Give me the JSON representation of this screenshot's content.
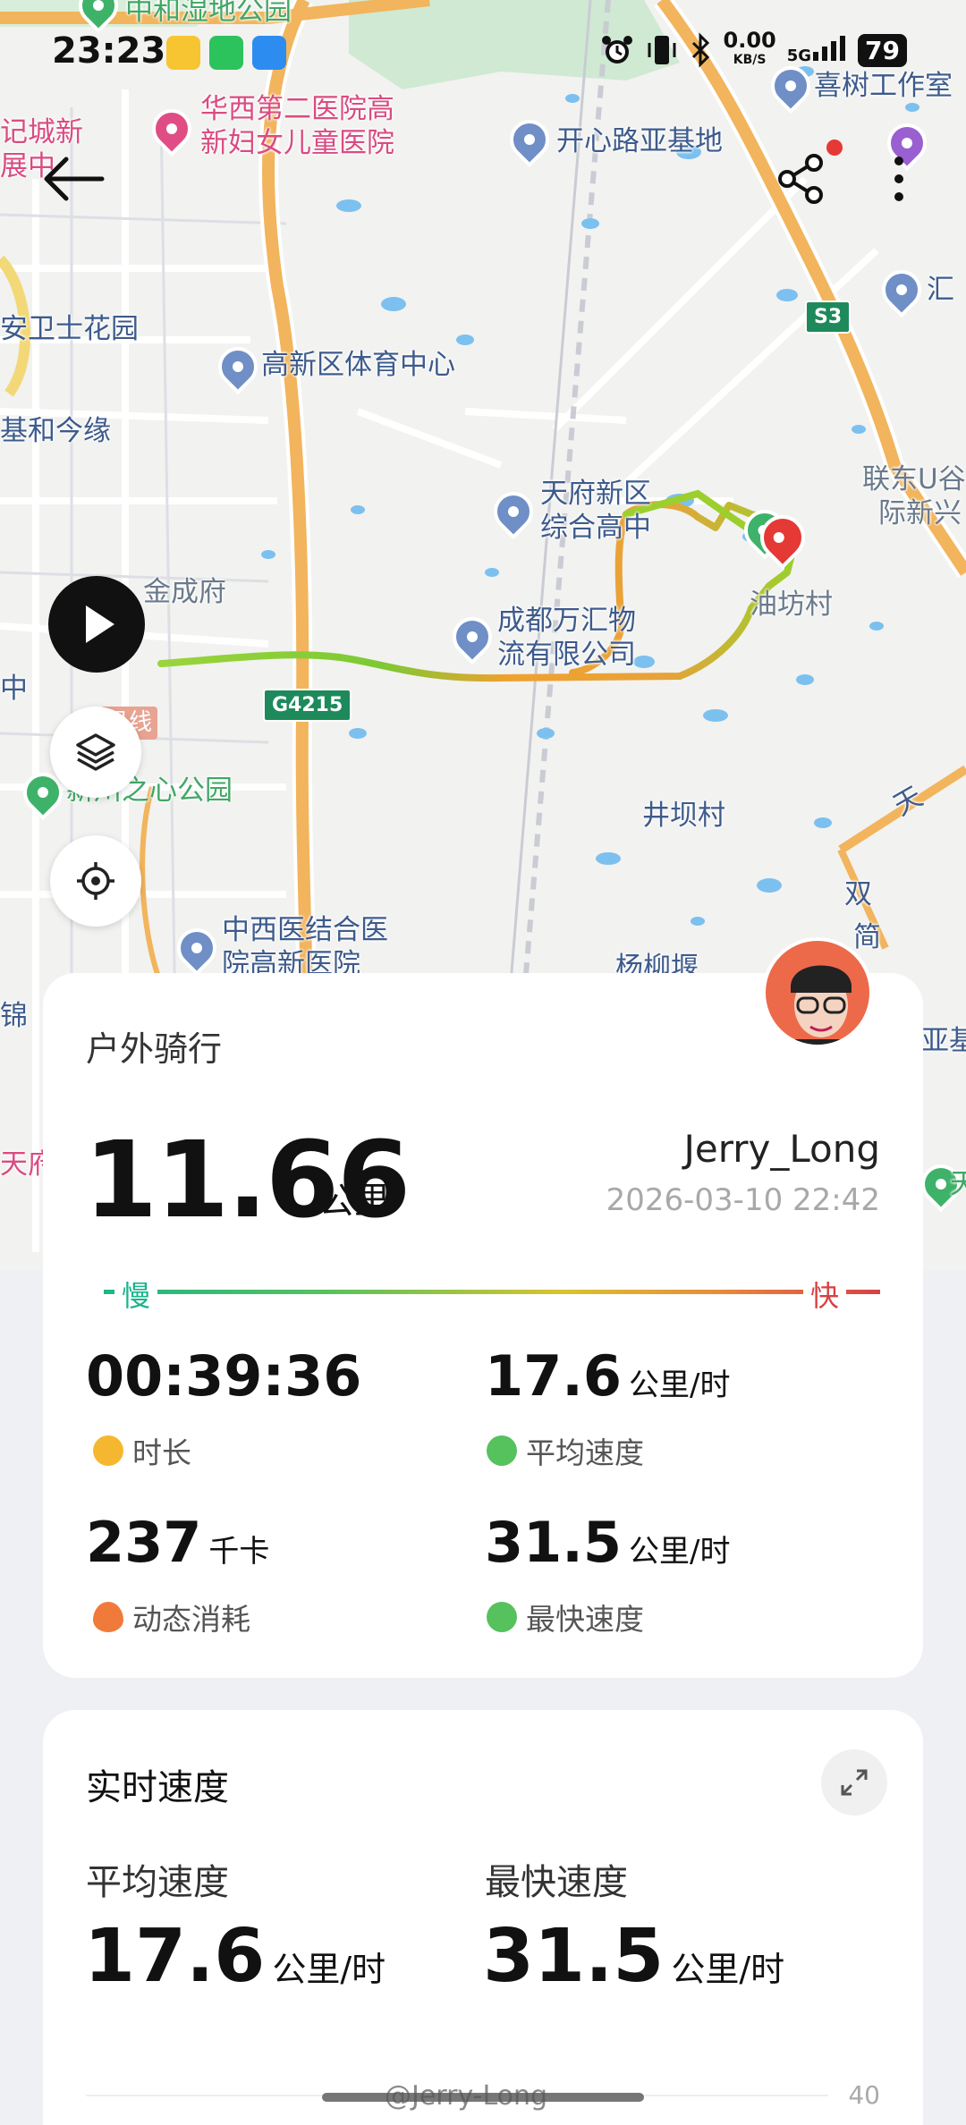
{
  "status_bar": {
    "time": "23:23",
    "net_speed": "0.00",
    "net_unit": "KB/S",
    "net_type": "5G",
    "battery": "79"
  },
  "map": {
    "pois": {
      "p1": "中和湿地公园",
      "p2a": "华西第二医院高",
      "p2b": "新妇女儿童医院",
      "p3": "开心路亚基地",
      "p4": "喜树工作室",
      "p5": "汇",
      "p6a": "记城新",
      "p6b": "展中",
      "p7": "安卫士花园",
      "p8": "高新区体育中心",
      "p9": "基和今缘",
      "p10a": "天府新区",
      "p10b": "综合高中",
      "p11a": "联东U谷",
      "p11b": "际新兴",
      "p12": "金成府",
      "p13a": "成都万汇物",
      "p13b": "流有限公司",
      "p14": "油坊村",
      "p15": "中",
      "p16": "号线",
      "p17": "新川之心公园",
      "p18": "井坝村",
      "p19": "天",
      "p20": "双",
      "p21": "简",
      "p22a": "中西医结合医",
      "p22b": "院高新医院",
      "p23": "杨柳堰",
      "p24": "锦",
      "p25": "天府",
      "p26": "亚基",
      "p27": "天"
    },
    "road_s3": "S3",
    "road_g4215": "G4215"
  },
  "card1": {
    "activity": "户外骑行",
    "distance": "11.66",
    "distance_unit": "公里",
    "username": "Jerry_Long",
    "datetime": "2026-03-10 22:42",
    "slow_label": "慢",
    "fast_label": "快",
    "duration": "00:39:36",
    "duration_label": "时长",
    "avg_speed": "17.6",
    "avg_speed_unit": "公里/时",
    "avg_speed_label": "平均速度",
    "calories": "237",
    "calories_unit": "千卡",
    "calories_label": "动态消耗",
    "max_speed": "31.5",
    "max_speed_unit": "公里/时",
    "max_speed_label": "最快速度"
  },
  "card2": {
    "title": "实时速度",
    "avg_label": "平均速度",
    "avg_value": "17.6",
    "avg_unit": "公里/时",
    "max_label": "最快速度",
    "max_value": "31.5",
    "max_unit": "公里/时",
    "axis_top": "40"
  },
  "watermark": "@Jerry-Long",
  "colors": {
    "slow": "#1ab48c",
    "fast": "#d84143",
    "route_start": "#7cc934",
    "route_end": "#f0a12e"
  }
}
